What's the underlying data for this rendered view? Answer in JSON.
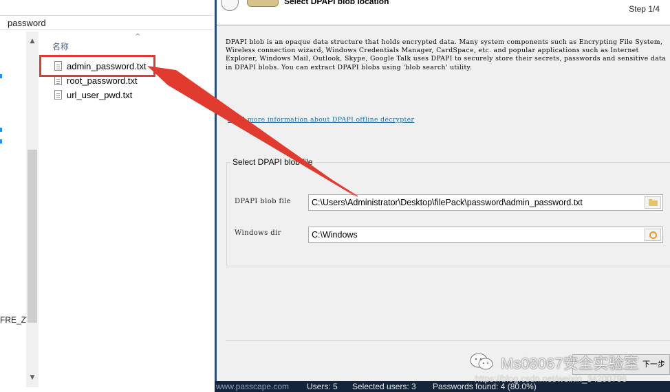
{
  "explorer": {
    "address_text": "password",
    "column_header": "名称",
    "nav_fragment": "FRE_ZH",
    "files": [
      {
        "name": "admin_password.txt"
      },
      {
        "name": "root_password.txt"
      },
      {
        "name": "url_user_pwd.txt"
      }
    ]
  },
  "wizard": {
    "title": "Select DPAPI blob location",
    "step": "Step 1/4",
    "description": "DPAPI blob is an opaque data structure that holds encrypted data. Many system components such as Encrypting File System, Wireless connection wizard, Windows Credentials Manager, CardSpace, etc. and popular applications such as Internet Explorer, Windows Mail, Outlook, Skype, Google Talk uses DPAPI to securely store their secrets, passwords and sensitive data in DPAPI blobs. You can extract DPAPI blobs using 'blob search' utility.",
    "link_text": "Read more information about DPAPI offline decrypter",
    "group_title": "Select DPAPI blob file",
    "blob_label": "DPAPI blob file",
    "blob_value": "C:\\Users\\Administrator\\Desktop\\filePack\\password\\admin_password.txt",
    "windir_label": "Windows dir",
    "windir_value": "C:\\Windows",
    "next_label": "下一步"
  },
  "status": {
    "site": "www.passcape.com",
    "users": "Users: 5",
    "selected": "Selected users: 3",
    "found": "Passwords found: 4 (80.0%)"
  },
  "watermark": {
    "text": "Ms08067安全实验室",
    "url": "https://blog.csdn.net/weixin_34200796"
  },
  "colors": {
    "annotation": "#e13b30",
    "status_bg": "#14243a",
    "link": "#1d6fa6"
  }
}
